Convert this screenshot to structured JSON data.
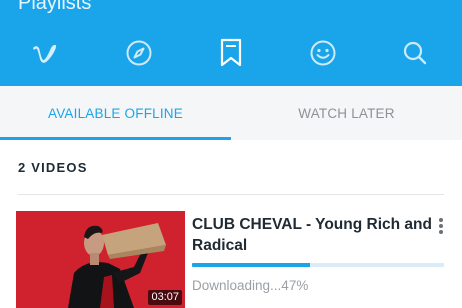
{
  "header": {
    "title": "Playlists",
    "nav_icons": [
      "vimeo-logo-icon",
      "compass-icon",
      "bookmark-icon",
      "smiley-icon",
      "search-icon"
    ]
  },
  "tabs": [
    {
      "label": "AVAILABLE OFFLINE",
      "active": true
    },
    {
      "label": "WATCH LATER",
      "active": false
    }
  ],
  "section": {
    "title": "2 VIDEOS"
  },
  "videos": [
    {
      "title": "CLUB CHEVAL - Young Rich and Radical",
      "duration": "03:07",
      "status": "Downloading...47%",
      "progress": 0.47
    }
  ],
  "colors": {
    "accent": "#1aa5ea",
    "tab_bar_bg": "#f5f6f7",
    "thumbnail_bg": "#d92531"
  }
}
